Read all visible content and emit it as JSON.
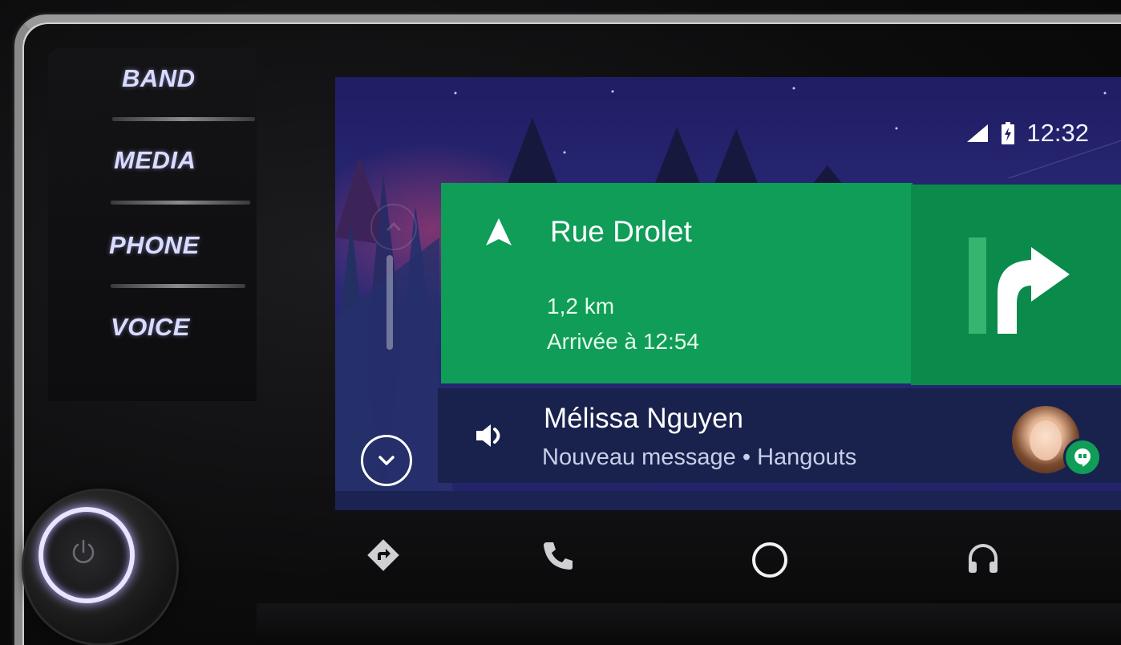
{
  "head_unit": {
    "buttons": [
      {
        "label": "BAND"
      },
      {
        "label": "MEDIA"
      },
      {
        "label": "PHONE"
      },
      {
        "label": "VOICE"
      }
    ],
    "knob_icon": "power-icon"
  },
  "status_bar": {
    "time": "12:32",
    "icons": [
      "signal-icon",
      "battery-charging-icon"
    ]
  },
  "navigation_card": {
    "street": "Rue Drolet",
    "distance": "1,2 km",
    "arrival": "Arrivée à 12:54",
    "direction_icon": "navigation-arrow-icon",
    "maneuver_icon": "turn-right-icon",
    "color": "#0f9d58"
  },
  "message_card": {
    "sender": "Mélissa Nguyen",
    "subtitle": "Nouveau message • Hangouts",
    "icon": "speaker-icon",
    "app_badge_icon": "hangouts-icon"
  },
  "bottom_nav": {
    "items": [
      {
        "icon": "navigation-icon"
      },
      {
        "icon": "phone-icon"
      },
      {
        "icon": "home-icon"
      },
      {
        "icon": "headphones-icon"
      }
    ]
  }
}
